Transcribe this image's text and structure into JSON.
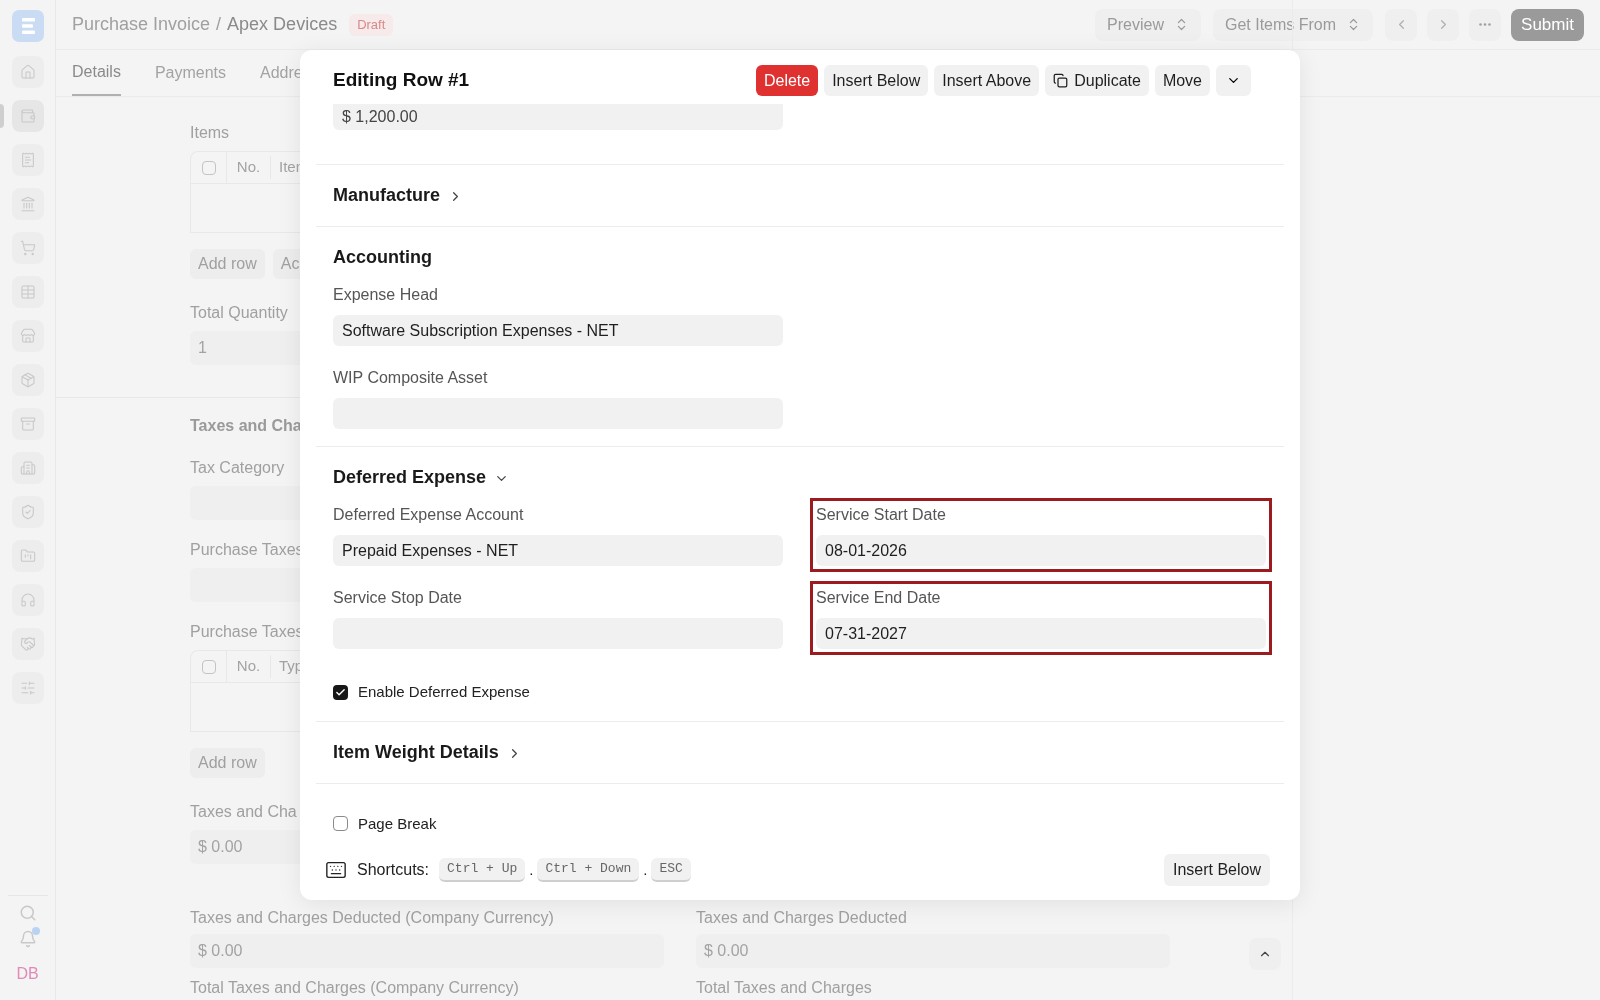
{
  "sidebar": {
    "items": [
      {
        "selected": false
      },
      {
        "selected": true
      },
      {
        "selected": false
      },
      {
        "selected": false
      },
      {
        "selected": false
      },
      {
        "selected": false
      },
      {
        "selected": false
      },
      {
        "selected": false
      },
      {
        "selected": false
      },
      {
        "selected": false
      },
      {
        "selected": false
      },
      {
        "selected": false
      },
      {
        "selected": false
      },
      {
        "selected": false
      },
      {
        "selected": false
      }
    ],
    "notifications_unread": true,
    "user_initials": "DB"
  },
  "header": {
    "breadcrumb": [
      "Purchase Invoice",
      "Apex Devices"
    ],
    "separator": "/",
    "status": "Draft",
    "preview": "Preview",
    "get_items": "Get Items From",
    "submit": "Submit"
  },
  "tabs": [
    {
      "label": "Details",
      "selected": true
    },
    {
      "label": "Payments",
      "selected": false
    },
    {
      "label": "Addre",
      "selected": false
    }
  ],
  "background_form": {
    "left_blocks": [
      {
        "kind": "label",
        "text": "Items"
      },
      {
        "kind": "table",
        "columns": [
          "No.",
          "Iten"
        ],
        "checked": false
      },
      {
        "kind": "buttons",
        "labels": [
          "Add row",
          "Ac"
        ]
      },
      {
        "kind": "label",
        "text": "Total Quantity"
      },
      {
        "kind": "field",
        "value": "1"
      },
      {
        "kind": "section",
        "text": "Taxes and Cha"
      },
      {
        "kind": "label",
        "text": "Tax Category"
      },
      {
        "kind": "field"
      },
      {
        "kind": "label",
        "text": "Purchase Taxes"
      },
      {
        "kind": "field"
      },
      {
        "kind": "label",
        "text": "Purchase Taxes"
      },
      {
        "kind": "table",
        "columns": [
          "No.",
          "Typ"
        ],
        "checked": false
      },
      {
        "kind": "buttons",
        "labels": [
          "Add row"
        ]
      },
      {
        "kind": "label",
        "text": "Taxes and Cha"
      },
      {
        "kind": "field",
        "value": "$ 0.00"
      }
    ],
    "bottom_rows": [
      [
        {
          "label": "Taxes and Charges Deducted (Company Currency)",
          "value": "$ 0.00"
        },
        {
          "label": "Taxes and Charges Deducted",
          "value": "$ 0.00"
        }
      ],
      [
        {
          "label": "Total Taxes and Charges (Company Currency)"
        },
        {
          "label": "Total Taxes and Charges"
        }
      ]
    ]
  },
  "dialog": {
    "title": "Editing Row #1",
    "actions": [
      {
        "label": "Delete",
        "kind": "danger"
      },
      {
        "label": "Insert Below",
        "kind": "plain"
      },
      {
        "label": "Insert Above",
        "kind": "plain"
      },
      {
        "label": "Duplicate",
        "kind": "copy"
      },
      {
        "label": "Move",
        "kind": "plain"
      }
    ],
    "partial_value": "$ 1,200.00",
    "sections": [
      {
        "title": "Manufacture",
        "kind": "collapsible",
        "expanded": false
      },
      {
        "title": "Accounting",
        "kind": "plain",
        "columns": [
          [
            {
              "kind": "input",
              "label": "Expense Head",
              "value": "Software Subscription Expenses - NET",
              "highlighted": false
            },
            {
              "kind": "input",
              "label": "WIP Composite Asset",
              "highlighted": false
            }
          ]
        ]
      },
      {
        "title": "Deferred Expense",
        "kind": "collapsible",
        "expanded": true,
        "columns": [
          [
            {
              "kind": "input",
              "label": "Deferred Expense Account",
              "value": "Prepaid Expenses - NET",
              "highlighted": false
            },
            {
              "kind": "input",
              "label": "Service Stop Date",
              "highlighted": false
            },
            {
              "kind": "checkbox",
              "label": "Enable Deferred Expense",
              "checked": true
            }
          ],
          [
            {
              "kind": "input",
              "label": "Service Start Date",
              "value": "08-01-2026",
              "highlighted": true
            },
            {
              "kind": "input",
              "label": "Service End Date",
              "value": "07-31-2027",
              "highlighted": true
            }
          ]
        ]
      },
      {
        "title": "Item Weight Details",
        "kind": "collapsible",
        "expanded": false
      },
      {
        "kind": "plain",
        "columns": [
          [
            {
              "kind": "checkbox",
              "label": "Page Break",
              "checked": false
            }
          ]
        ]
      }
    ],
    "shortcuts": {
      "label": "Shortcuts:",
      "keys": [
        "Ctrl + Up",
        "Ctrl + Down",
        "ESC"
      ],
      "separator": "."
    },
    "footer_button": "Insert Below"
  }
}
